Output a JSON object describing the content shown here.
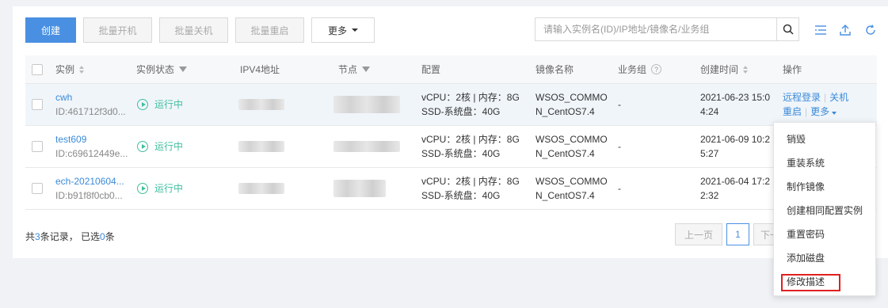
{
  "toolbar": {
    "create": "创建",
    "batch_start": "批量开机",
    "batch_stop": "批量关机",
    "batch_restart": "批量重启",
    "more": "更多"
  },
  "search": {
    "placeholder": "请输入实例名(ID)/IP地址/镜像名/业务组"
  },
  "table": {
    "headers": {
      "instance": "实例",
      "status": "实例状态",
      "ipv4": "IPV4地址",
      "node": "节点",
      "config": "配置",
      "image": "镜像名称",
      "group": "业务组",
      "created": "创建时间",
      "actions": "操作"
    },
    "rows": [
      {
        "name": "cwh",
        "id": "ID:461712f3d0...",
        "status": "运行中",
        "config_line1": "vCPU：2核 | 内存：8G",
        "config_line2": "SSD-系统盘：40G",
        "image_line1": "WSOS_COMMO",
        "image_line2": "N_CentOS7.4",
        "group": "-",
        "created_line1": "2021-06-23 15:0",
        "created_line2": "4:24"
      },
      {
        "name": "test609",
        "id": "ID:c69612449e...",
        "status": "运行中",
        "config_line1": "vCPU：2核 | 内存：8G",
        "config_line2": "SSD-系统盘：40G",
        "image_line1": "WSOS_COMMO",
        "image_line2": "N_CentOS7.4",
        "group": "-",
        "created_line1": "2021-06-09 10:2",
        "created_line2": "5:27"
      },
      {
        "name": "ech-20210604...",
        "id": "ID:b91f8f0cb0...",
        "status": "运行中",
        "config_line1": "vCPU：2核 | 内存：8G",
        "config_line2": "SSD-系统盘：40G",
        "image_line1": "WSOS_COMMO",
        "image_line2": "N_CentOS7.4",
        "group": "-",
        "created_line1": "2021-06-04 17:2",
        "created_line2": "2:32"
      }
    ],
    "actions": {
      "remote_login": "远程登录",
      "shutdown": "关机",
      "restart": "重启",
      "more": "更多"
    }
  },
  "footer": {
    "total_prefix": "共",
    "total_count": "3",
    "total_mid": "条记录， 已选",
    "selected_count": "0",
    "total_suffix": "条"
  },
  "pagination": {
    "prev": "上一页",
    "page": "1",
    "next": "下一"
  },
  "dropdown": {
    "items": [
      "销毁",
      "重装系统",
      "制作镜像",
      "创建相同配置实例",
      "重置密码",
      "添加磁盘",
      "修改描述"
    ]
  },
  "colors": {
    "primary": "#4a90e2",
    "link": "#3b8ad9",
    "running": "#3fbf9f",
    "highlight": "#e02020"
  }
}
